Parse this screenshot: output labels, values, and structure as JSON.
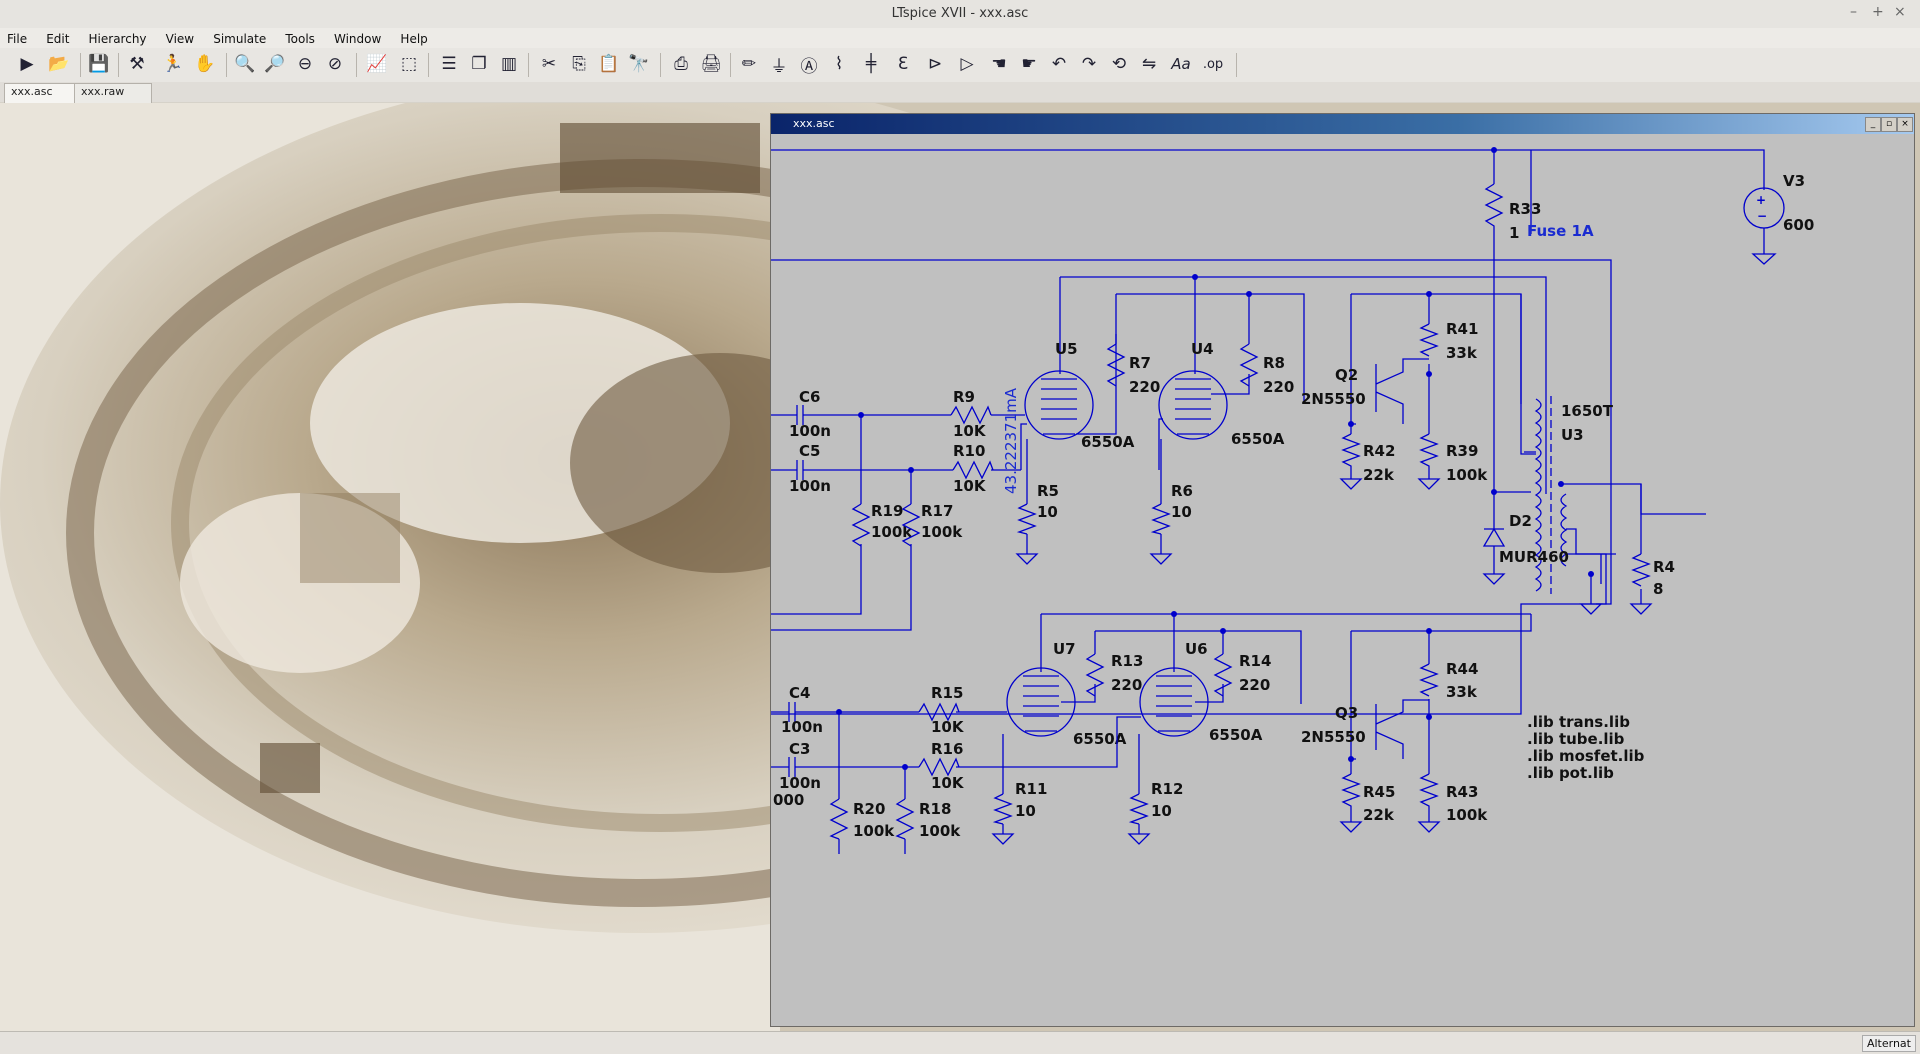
{
  "window": {
    "title": "LTspice XVII - xxx.asc",
    "minimize": "–",
    "maximize": "+",
    "close": "×"
  },
  "menu": [
    "File",
    "Edit",
    "Hierarchy",
    "View",
    "Simulate",
    "Tools",
    "Window",
    "Help"
  ],
  "toolbar": {
    "icons": [
      "run-icon",
      "open-icon",
      "save-icon",
      "hammer-icon",
      "runner-icon",
      "pan-hand-icon",
      "zoom-in-icon",
      "zoom-area-icon",
      "zoom-out-icon",
      "zoom-cancel-icon",
      "waveform-icon",
      "autorange-icon",
      "tile-horizontal-icon",
      "cascade-icon",
      "tile-vertical-icon",
      "cut-icon",
      "copy-icon",
      "paste-icon",
      "find-icon",
      "print-setup-icon",
      "print-icon",
      "pencil-icon",
      "ground-icon",
      "label-icon",
      "resistor-icon",
      "capacitor-icon",
      "inductor-icon",
      "diode-icon",
      "component-icon",
      "move-icon",
      "drag-icon",
      "undo-icon",
      "redo-icon",
      "rotate-icon",
      "mirror-icon",
      "text-icon",
      "spice-directive-icon"
    ],
    "text_tool": "Aa",
    "op_tool": ".op"
  },
  "tabs": [
    {
      "label": "xxx.asc"
    },
    {
      "label": "xxx.raw"
    }
  ],
  "schematic": {
    "title": "xxx.asc",
    "labels": {
      "v3": "V3",
      "v3_val": "600",
      "r33": "R33",
      "r33_val": "1",
      "fuse": "Fuse 1A",
      "u5": "U5",
      "u4": "U4",
      "u7": "U7",
      "u6": "U6",
      "tube_u5": "6550A",
      "tube_u4": "6550A",
      "tube_u7": "6550A",
      "tube_u6": "6550A",
      "r7": "R7",
      "r7_val": "220",
      "r8": "R8",
      "r8_val": "220",
      "r13": "R13",
      "r13_val": "220",
      "r14": "R14",
      "r14_val": "220",
      "c6": "C6",
      "c6_val": "100n",
      "c5": "C5",
      "c5_val": "100n",
      "c4": "C4",
      "c4_val": "100n",
      "c3": "C3",
      "c3_val": "100n",
      "r9": "R9",
      "r9_val": "10K",
      "r10": "R10",
      "r10_val": "10K",
      "r15": "R15",
      "r15_val": "10K",
      "r16": "R16",
      "r16_val": "10K",
      "r19": "R19",
      "r19_val": "100k",
      "r17": "R17",
      "r17_val": "100k",
      "r20": "R20",
      "r20_val": "100k",
      "r18": "R18",
      "r18_val": "100k",
      "r5": "R5",
      "r5_val": "10",
      "r6": "R6",
      "r6_val": "10",
      "r11": "R11",
      "r11_val": "10",
      "r12": "R12",
      "r12_val": "10",
      "q2": "Q2",
      "q2_val": "2N5550",
      "q3": "Q3",
      "q3_val": "2N5550",
      "r41": "R41",
      "r41_val": "33k",
      "r42": "R42",
      "r42_val": "22k",
      "r39": "R39",
      "r39_val": "100k",
      "r44": "R44",
      "r44_val": "33k",
      "r45": "R45",
      "r45_val": "22k",
      "r43": "R43",
      "r43_val": "100k",
      "t1650": "1650T",
      "u3": "U3",
      "d2": "D2",
      "d2_val": "MUR460",
      "r4": "R4",
      "r4_val": "8",
      "current": "43.222371mA",
      "frag": "000",
      "lib1": ".lib trans.lib",
      "lib2": ".lib tube.lib",
      "lib3": ".lib mosfet.lib",
      "lib4": ".lib pot.lib"
    }
  },
  "status": {
    "mode": "Alternat"
  }
}
